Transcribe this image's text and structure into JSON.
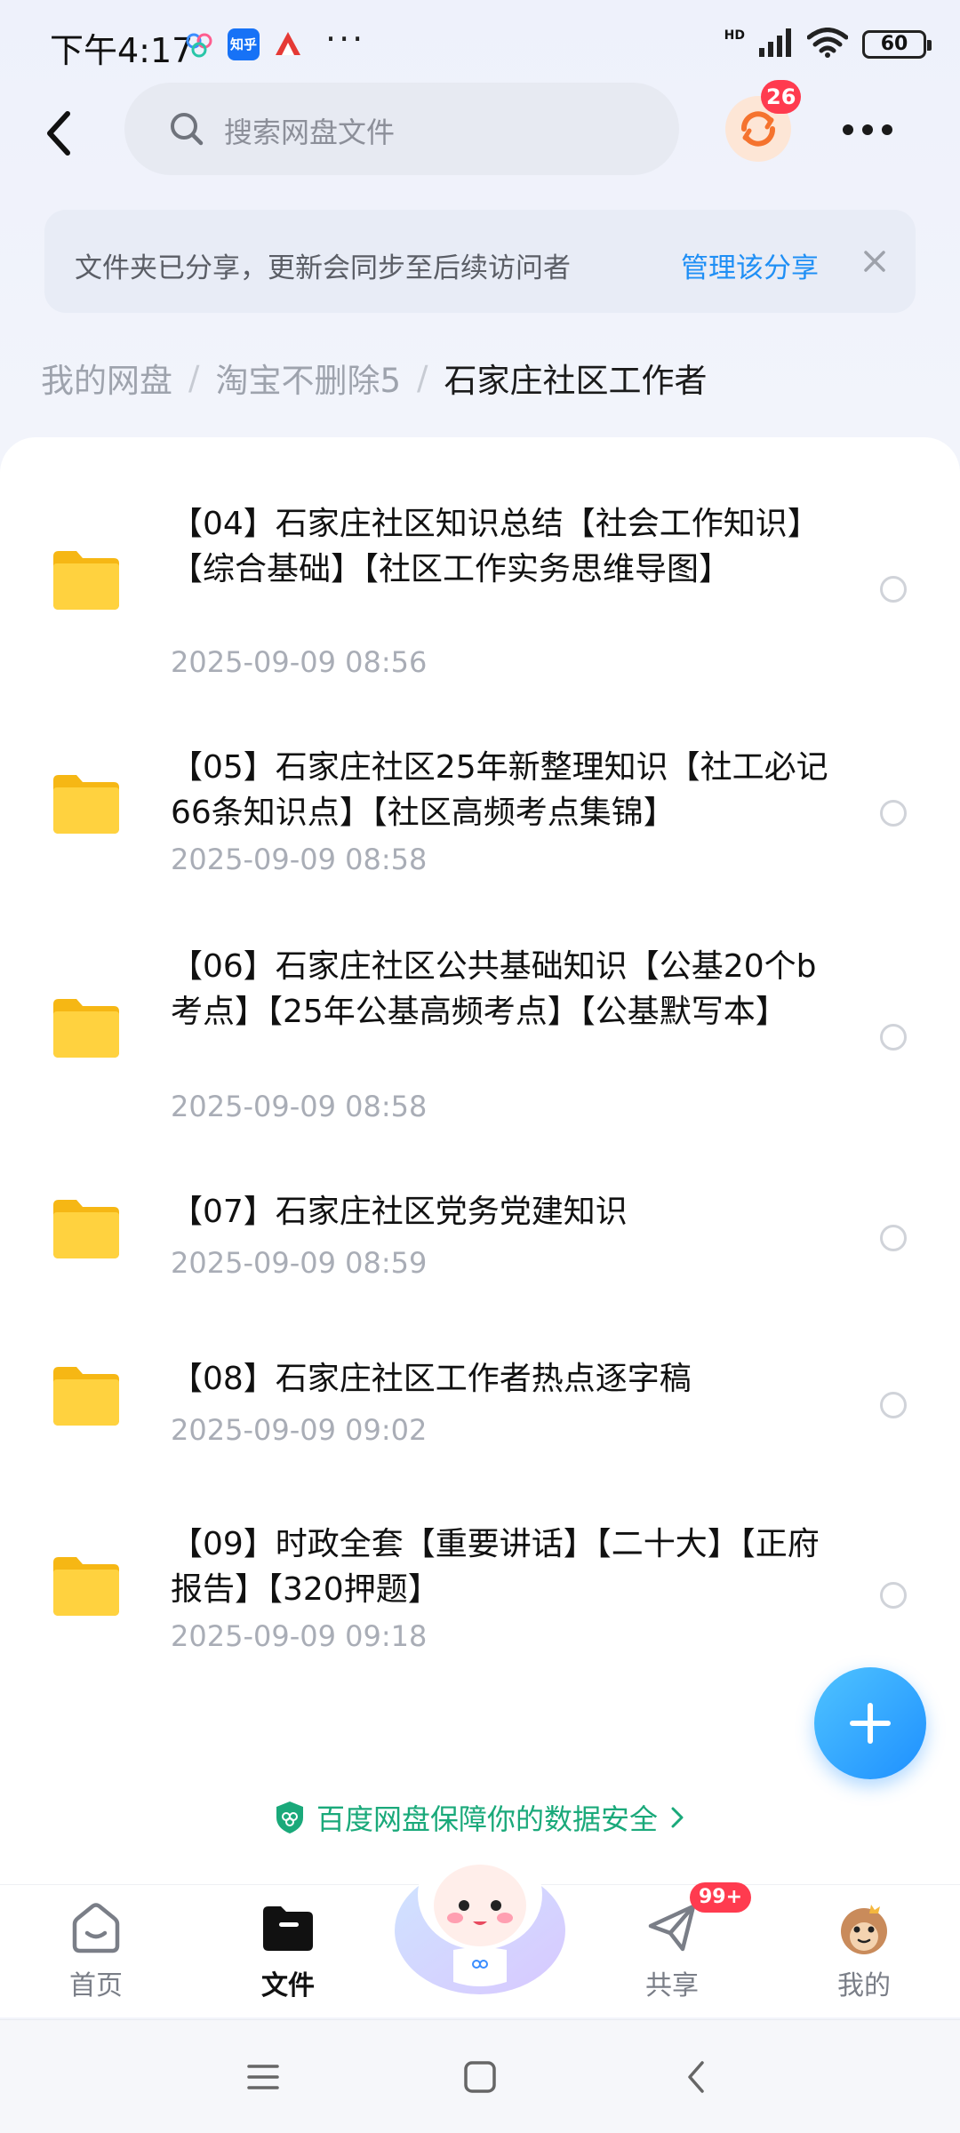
{
  "status_bar": {
    "time": "下午4:17",
    "zhihu_label": "知乎",
    "dots": "···",
    "network": "HD",
    "battery": "60"
  },
  "header": {
    "search_placeholder": "搜索网盘文件",
    "sync_badge": "26"
  },
  "notice": {
    "text": "文件夹已分享，更新会同步至后续访问者",
    "link": "管理该分享"
  },
  "breadcrumb": {
    "items": [
      "我的网盘",
      "淘宝不删除5"
    ],
    "current": "石家庄社区工作者",
    "separator": "/"
  },
  "files": [
    {
      "name": "【04】石家庄社区知识总结【社会工作知识】【综合基础】【社区工作实务思维导图】",
      "time": "2025-09-09  08:56"
    },
    {
      "name": "【05】石家庄社区25年新整理知识【社工必记66条知识点】【社区高频考点集锦】",
      "time": "2025-09-09  08:58"
    },
    {
      "name": "【06】石家庄社区公共基础知识【公基20个b考点】【25年公基高频考点】【公基默写本】",
      "time": "2025-09-09  08:58"
    },
    {
      "name": "【07】石家庄社区党务党建知识",
      "time": "2025-09-09  08:59"
    },
    {
      "name": "【08】石家庄社区工作者热点逐字稿",
      "time": "2025-09-09  09:02"
    },
    {
      "name": "【09】时政全套【重要讲话】【二十大】【正府报告】【320押题】",
      "time": "2025-09-09  09:18"
    }
  ],
  "security_note": "百度网盘保障你的数据安全",
  "bottom_nav": {
    "home": "首页",
    "files": "文件",
    "share": "共享",
    "share_badge": "99+",
    "mine": "我的"
  },
  "colors": {
    "accent": "#1f8ff5",
    "folder": "#ffd23f",
    "badge": "#ff3b4f",
    "security": "#1aa97a"
  }
}
